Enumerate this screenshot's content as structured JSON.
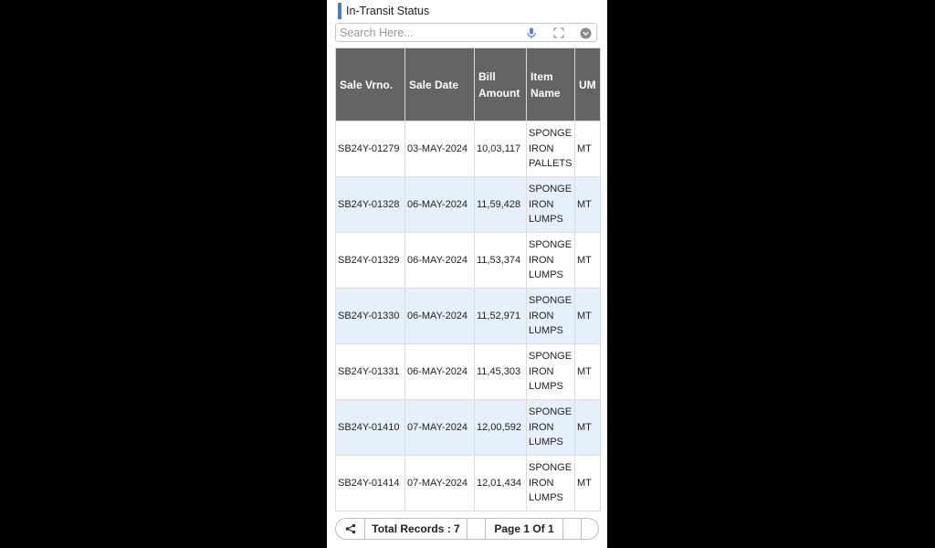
{
  "header": {
    "title": "In-Transit Status"
  },
  "search": {
    "placeholder": "Search Here..."
  },
  "table": {
    "columns": [
      "Sale Vrno.",
      "Sale Date",
      "Bill Amount",
      "Item Name",
      "UM"
    ],
    "rows": [
      [
        "SB24Y-01279",
        "03-MAY-2024",
        "10,03,117",
        "SPONGE IRON PALLETS",
        "MT"
      ],
      [
        "SB24Y-01328",
        "06-MAY-2024",
        "11,59,428",
        "SPONGE IRON LUMPS",
        "MT"
      ],
      [
        "SB24Y-01329",
        "06-MAY-2024",
        "11,53,374",
        "SPONGE IRON LUMPS",
        "MT"
      ],
      [
        "SB24Y-01330",
        "06-MAY-2024",
        "11,52,971",
        "SPONGE IRON LUMPS",
        "MT"
      ],
      [
        "SB24Y-01331",
        "06-MAY-2024",
        "11,45,303",
        "SPONGE IRON LUMPS",
        "MT"
      ],
      [
        "SB24Y-01410",
        "07-MAY-2024",
        "12,00,592",
        "SPONGE IRON LUMPS",
        "MT"
      ],
      [
        "SB24Y-01414",
        "07-MAY-2024",
        "12,01,434",
        "SPONGE IRON LUMPS",
        "MT"
      ]
    ]
  },
  "footer": {
    "total_records": "Total Records : 7",
    "page": "Page 1 Of 1"
  },
  "icons": {
    "share": "share-icon",
    "mic": "mic-icon",
    "expand": "expand-icon",
    "dropdown": "chevron-down-circle-icon"
  },
  "colors": {
    "header_bg": "#626466",
    "alt_row": "#e6f0fb",
    "accent": "#4a7dbf"
  }
}
